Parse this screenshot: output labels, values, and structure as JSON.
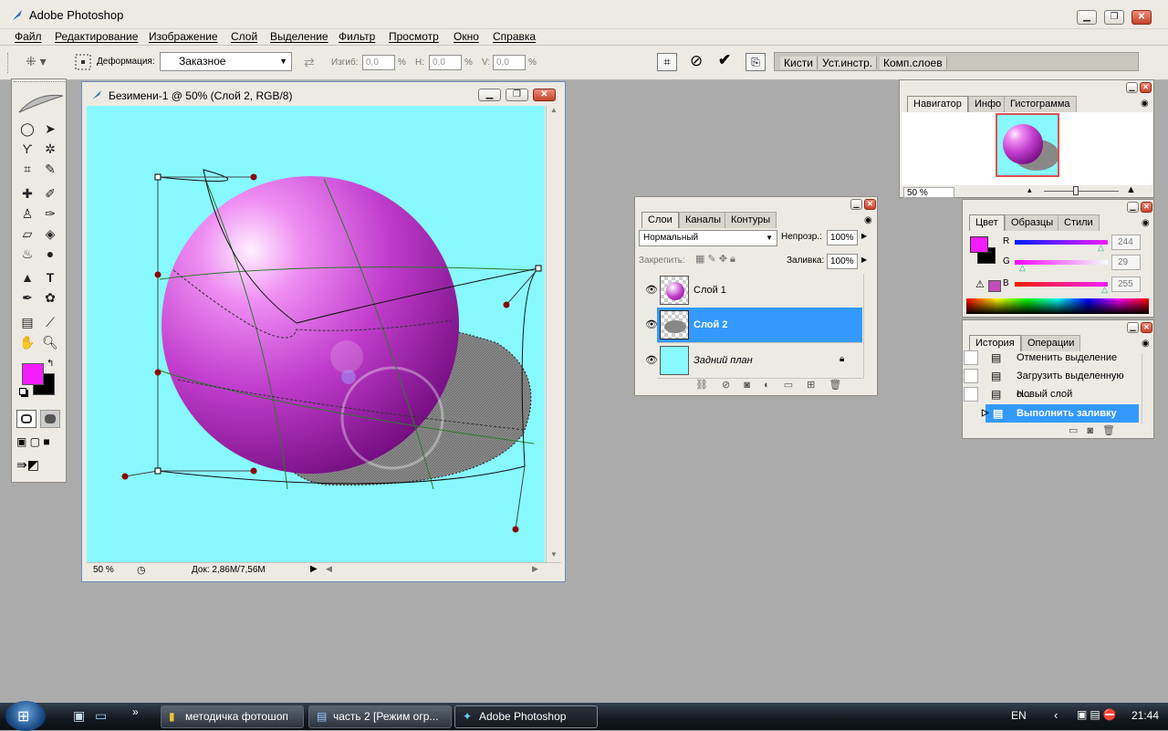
{
  "app": {
    "title": "Adobe Photoshop"
  },
  "menu": [
    "Файл",
    "Редактирование",
    "Изображение",
    "Слой",
    "Выделение",
    "Фильтр",
    "Просмотр",
    "Окно",
    "Справка"
  ],
  "options": {
    "warp_label": "Деформация:",
    "warp_value": "Заказное",
    "bend_label": "Изгиб:",
    "bend_value": "0,0",
    "h_label": "H:",
    "h_value": "0,0",
    "v_label": "V:",
    "v_value": "0,0",
    "percent": "%",
    "palette_well": [
      "Кисти",
      "Уст.инстр.",
      "Комп.слоев"
    ]
  },
  "document": {
    "title": "Безимени-1 @ 50% (Слой 2, RGB/8)",
    "zoom": "50 %",
    "doc_info": "Док: 2,86M/7,56M",
    "background_color": "#88f8ff"
  },
  "navigator": {
    "tabs": [
      "Навигатор",
      "Инфо",
      "Гистограмма"
    ],
    "zoom": "50 %"
  },
  "layers": {
    "tabs": [
      "Слои",
      "Каналы",
      "Контуры"
    ],
    "blend_mode": "Нормальный",
    "opacity_label": "Непрозр.:",
    "opacity_value": "100%",
    "lock_label": "Закрепить:",
    "fill_label": "Заливка:",
    "fill_value": "100%",
    "items": [
      {
        "name": "Слой 1",
        "selected": false
      },
      {
        "name": "Слой 2",
        "selected": true
      },
      {
        "name": "Задний план",
        "selected": false
      }
    ]
  },
  "color": {
    "tabs": [
      "Цвет",
      "Образцы",
      "Стили"
    ],
    "channels": [
      {
        "label": "R",
        "value": "244"
      },
      {
        "label": "G",
        "value": "29"
      },
      {
        "label": "B",
        "value": "255"
      }
    ],
    "foreground": "#f41dff",
    "background": "#000000"
  },
  "history": {
    "tabs": [
      "История",
      "Операции"
    ],
    "items": [
      {
        "name": "Отменить выделение",
        "selected": false
      },
      {
        "name": "Загрузить выделенную о...",
        "selected": false
      },
      {
        "name": "Новый слой",
        "selected": false
      },
      {
        "name": "Выполнить заливку",
        "selected": true
      }
    ]
  },
  "taskbar": {
    "items": [
      {
        "label": "методичка фотошоп",
        "active": false
      },
      {
        "label": "часть 2 [Режим огр...",
        "active": false
      },
      {
        "label": "Adobe Photoshop",
        "active": true
      }
    ],
    "lang": "EN",
    "time": "21:44"
  }
}
